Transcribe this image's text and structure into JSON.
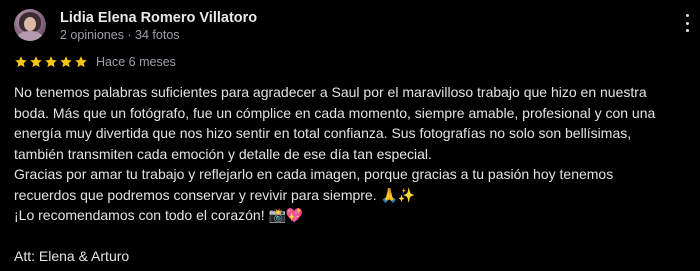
{
  "reviewer": {
    "name": "Lidia Elena Romero Villatoro",
    "meta": "2 opiniones · 34 fotos",
    "avatar_icon": "profile-photo"
  },
  "rating": {
    "stars": 5,
    "max": 5,
    "color": "#f5c518",
    "time": "Hace 6 meses"
  },
  "review": {
    "lines": [
      "No tenemos palabras suficientes para agradecer a Saul por el maravilloso trabajo que hizo en nuestra",
      "boda. Más que un fotógrafo, fue un cómplice en cada momento, siempre amable, profesional y con una",
      "energía muy divertida que nos hizo sentir en total confianza. Sus fotografías no solo son bellísimas,",
      "también transmiten cada emoción y detalle de ese día tan especial.",
      "Gracias por amar tu trabajo y reflejarlo en cada imagen, porque gracias a tu pasión hoy tenemos",
      "recuerdos que podremos conservar y revivir para siempre. 🙏✨",
      "¡Lo recomendamos con todo el corazón! 📸💖",
      "",
      "Att: Elena & Arturo"
    ]
  }
}
